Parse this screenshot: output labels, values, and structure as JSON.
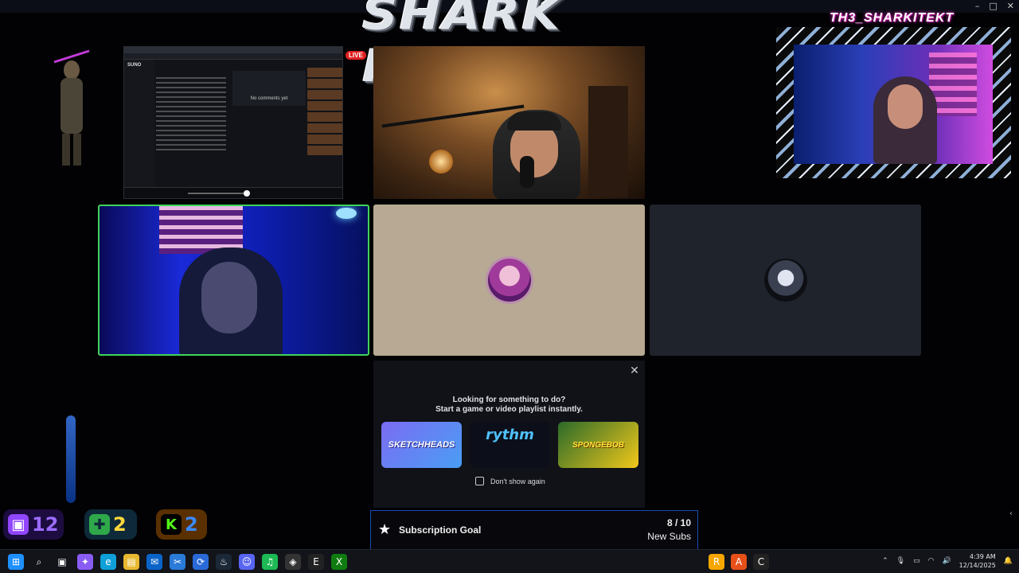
{
  "window": {
    "controls": [
      "–",
      "□",
      "✕"
    ]
  },
  "banner": {
    "title": "SHARK FAM"
  },
  "screenshare": {
    "logo": "SUNO",
    "comments_empty": "No comments yet",
    "live_badge": "LIVE"
  },
  "topright_cam": {
    "frame_title": "TH3_SHARKITEKT"
  },
  "activity": {
    "title_line1": "Looking for something to do?",
    "title_line2": "Start a game or video playlist instantly.",
    "close": "✕",
    "cards": [
      {
        "label": "SKETCHHEADS",
        "color": "#7b6cf2"
      },
      {
        "label": "rythm",
        "color": "#4fc0ff"
      },
      {
        "label": "SPONGEBOB",
        "color": "#ffe63a"
      }
    ],
    "dont_show_again": "Don't show again"
  },
  "subscription_goal": {
    "title": "Subscription Goal",
    "count": "8 / 10",
    "unit": "New Subs",
    "current": 8,
    "target": 10,
    "fill_color": "#1243c8"
  },
  "stats": {
    "twitch": {
      "icon": "twitch-icon",
      "value": "12"
    },
    "kick_a": {
      "icon": "kick-puzzle-icon",
      "value": "2"
    },
    "kick_b": {
      "icon": "kick-icon",
      "value": "2"
    }
  },
  "taskbar": {
    "apps": [
      {
        "name": "windows-start-icon",
        "glyph": "⊞",
        "color": "#1e90ff"
      },
      {
        "name": "search-icon",
        "glyph": "⌕",
        "color": "transparent"
      },
      {
        "name": "task-view-icon",
        "glyph": "▣",
        "color": "transparent"
      },
      {
        "name": "copilot-icon",
        "glyph": "✦",
        "color": "#8a5cf6"
      },
      {
        "name": "edge-icon",
        "glyph": "e",
        "color": "#0fa0d8"
      },
      {
        "name": "file-explorer-icon",
        "glyph": "▤",
        "color": "#e8b830"
      },
      {
        "name": "outlook-icon",
        "glyph": "✉",
        "color": "#0a64c8"
      },
      {
        "name": "snipping-tool-icon",
        "glyph": "✂",
        "color": "#2a7ad8"
      },
      {
        "name": "sync-icon",
        "glyph": "⟳",
        "color": "#2a6ad8"
      },
      {
        "name": "steam-icon",
        "glyph": "♨",
        "color": "#1b2838"
      },
      {
        "name": "discord-icon",
        "glyph": "☺",
        "color": "#5865f2"
      },
      {
        "name": "spotify-icon",
        "glyph": "♫",
        "color": "#1db954"
      },
      {
        "name": "davinci-icon",
        "glyph": "◈",
        "color": "#333"
      },
      {
        "name": "epic-games-icon",
        "glyph": "E",
        "color": "#222"
      },
      {
        "name": "xbox-icon",
        "glyph": "X",
        "color": "#107c10"
      }
    ],
    "mid_apps": [
      {
        "name": "rockstar-icon",
        "glyph": "R",
        "color": "#f7a600"
      },
      {
        "name": "adobe-icon",
        "glyph": "A",
        "color": "#e8501a"
      },
      {
        "name": "call-of-duty-icon",
        "glyph": "C",
        "color": "#222"
      }
    ],
    "time": "4:39 AM",
    "date": "12/14/2025"
  }
}
